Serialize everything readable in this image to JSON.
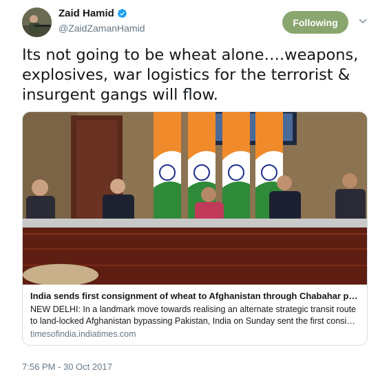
{
  "author": {
    "display_name": "Zaid Hamid",
    "handle": "@ZaidZamanHamid",
    "verified": true
  },
  "follow_button": {
    "label": "Following"
  },
  "tweet": {
    "text": "Its not going to be wheat alone….weapons, explosives, war logistics for the terrorist & insurgent gangs will flow.",
    "timestamp": "7:56 PM - 30 Oct 2017"
  },
  "link_card": {
    "title": "India sends first consignment of wheat to Afghanistan through Chabahar por…",
    "description": "NEW DELHI: In a landmark move towards realising an alternate strategic transit route to land-locked Afghanistan bypassing Pakistan, India on Sunday sent the first consi…",
    "domain": "timesofindia.indiatimes.com"
  },
  "colors": {
    "follow_button": "#8aa66f",
    "verified_badge": "#1da1f2",
    "secondary_text": "#657786"
  },
  "icons": {
    "verified": "verified-badge-icon",
    "caret": "chevron-down-icon"
  }
}
